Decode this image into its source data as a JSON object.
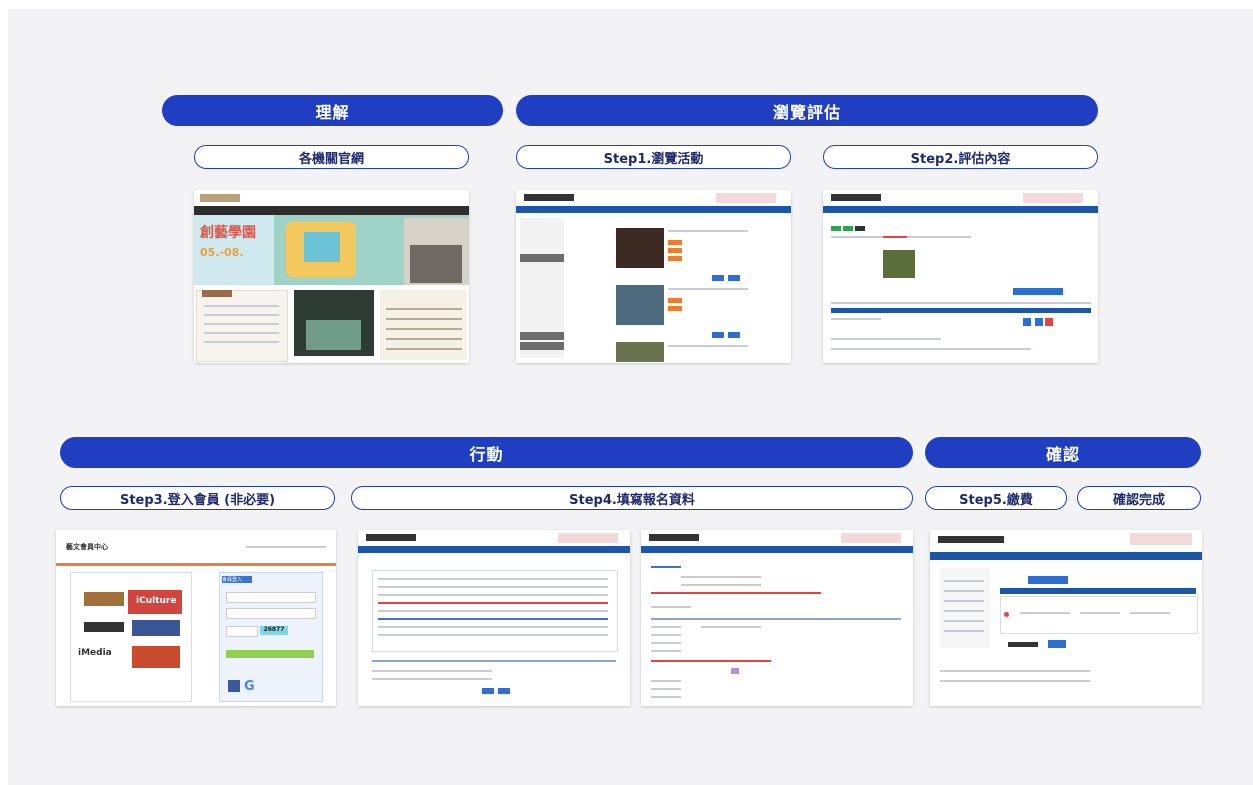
{
  "phases": {
    "understand": "理解",
    "browse_evaluate": "瀏覽評估",
    "action": "行動",
    "confirm": "確認"
  },
  "steps": {
    "official_sites": "各機關官網",
    "step1": "Step1.瀏覽活動",
    "step2": "Step2.評估內容",
    "step3": "Step3.登入會員 (非必要)",
    "step4": "Step4.填寫報名資料",
    "step5": "Step5.繳費",
    "done": "確認完成"
  },
  "thumbnails": {
    "official_site_banner": "創藝學園",
    "official_site_dates": "05.-08.",
    "member_center_title": "藝文會員中心",
    "member_login_tab": "會員登入",
    "member_captcha": "26877",
    "brand_iculture": "iCulture",
    "brand_imedia": "iMedia"
  },
  "colors": {
    "phase_bg": "#1f3ec2",
    "step_border": "#1f3ec2",
    "canvas_bg": "#f3f3f5"
  }
}
